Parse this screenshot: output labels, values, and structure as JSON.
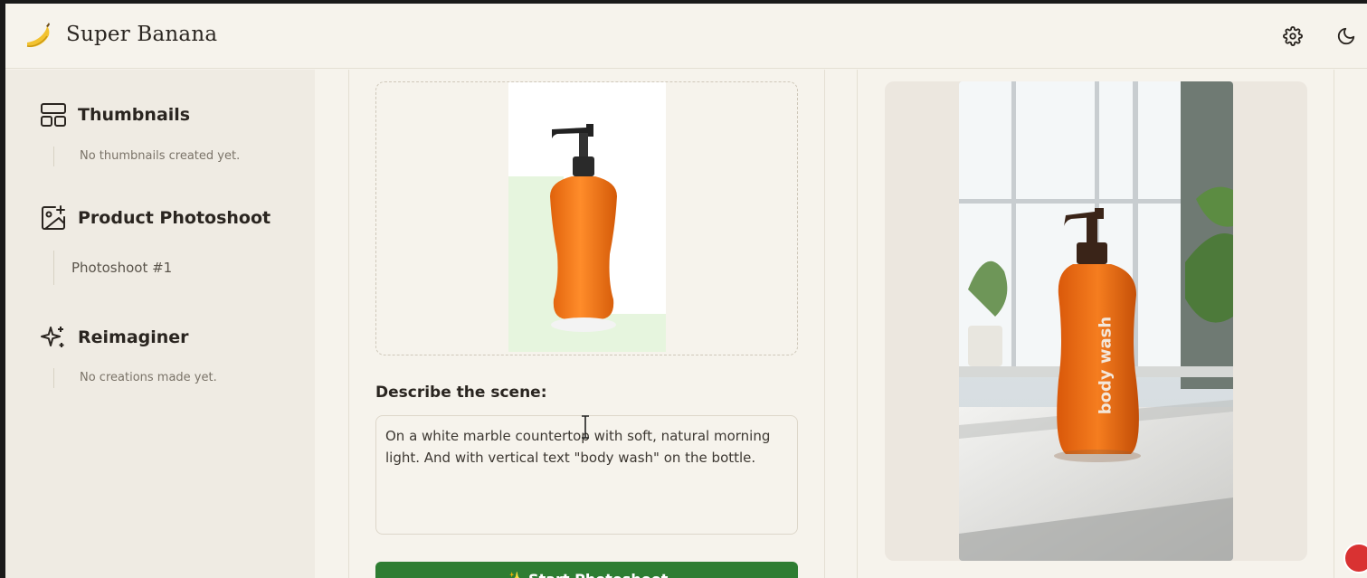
{
  "app": {
    "title": "Super Banana"
  },
  "header": {
    "settings_icon": "gear-icon",
    "theme_icon": "moon-icon"
  },
  "sidebar": {
    "sections": [
      {
        "label": "Thumbnails",
        "icon": "layout-icon",
        "empty_text": "No thumbnails created yet."
      },
      {
        "label": "Product Photoshoot",
        "icon": "image-plus-icon",
        "items": [
          "Photoshoot #1"
        ]
      },
      {
        "label": "Reimaginer",
        "icon": "sparkles-icon",
        "empty_text": "No creations made yet."
      }
    ]
  },
  "main": {
    "scene_label": "Describe the scene:",
    "scene_text": "On a white marble countertop with soft, natural morning light. And with vertical text \"body wash\" on the bottle.",
    "generate_label": "✨ Start Photoshoot"
  },
  "result": {
    "bottle_text": "body wash"
  },
  "colors": {
    "accent": "#2e7d32",
    "bottle": "#f07a1c",
    "background": "#f6f3ec"
  }
}
